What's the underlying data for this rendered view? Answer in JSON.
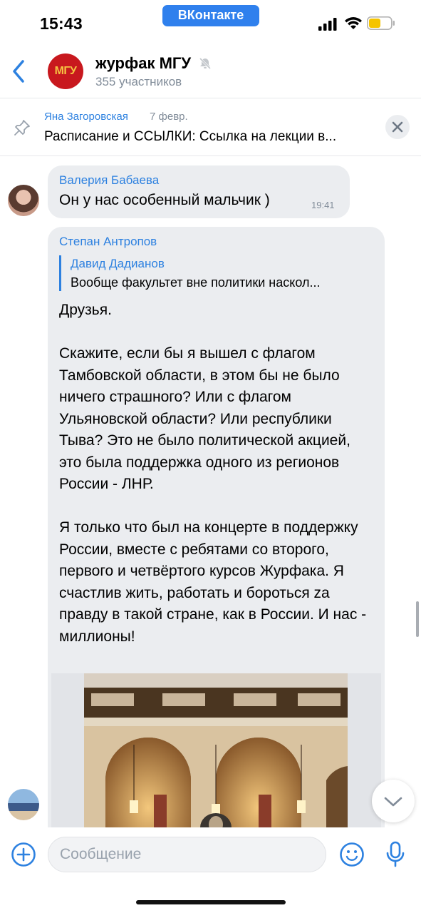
{
  "status_bar": {
    "time": "15:43",
    "app_pill": "ВКонтакте"
  },
  "header": {
    "back_icon": "chevron-left-icon",
    "avatar_text": "МГУ",
    "title": "журфак МГУ",
    "subtitle": "355 участников",
    "mute_icon": "muted-bell-icon"
  },
  "pinned": {
    "author": "Яна Загоровская",
    "date": "7 февр.",
    "text": "Расписание и ССЫЛКИ: Ссылка на лекции в...",
    "icon": "pin-icon"
  },
  "messages": [
    {
      "sender": "Валерия Бабаева",
      "text": "Он у нас особенный мальчик )",
      "time": "19:41"
    },
    {
      "sender": "Степан Антропов",
      "reply_author": "Давид Дадианов",
      "reply_text": "Вообще факультет вне политики наскол...",
      "text": "Друзья.\n\nСкажите, если бы я вышел с флагом Тамбовской области, в этом бы не было ничего страшного? Или с флагом Ульяновской области? Или республики Тыва? Это не было политической акцией, это была поддержка одного из регионов России - ЛНР.\n\nЯ только что был на концерте в поддержку России, вместе с ребятами со второго, первого и четвёртого курсов Журфака. Я счастлив жить, работать и бороться zа правду в такой стране, как в России. И нас - миллионы!"
    }
  ],
  "composer": {
    "placeholder": "Сообщение",
    "value": ""
  },
  "colors": {
    "accent": "#2d81e0",
    "bubble": "#ebedf0",
    "secondary_text": "#818c99"
  }
}
